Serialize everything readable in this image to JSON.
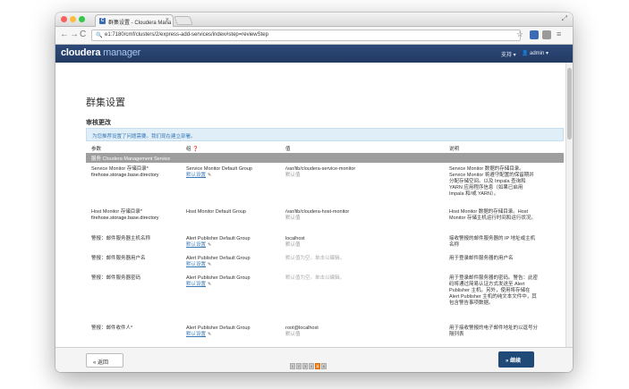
{
  "browser": {
    "tab_title": "群集设置 - Cloudera Mana",
    "tab_favicon": "C",
    "tab_close": "×",
    "url": "e1:7180/cmf/clusters/2/express-add-services/index#step=reviewStep",
    "url_icon": "🔍",
    "nav_back": "←",
    "nav_forward": "→",
    "nav_reload": "C",
    "star": "☆",
    "menu": "≡",
    "window_control": "⤢"
  },
  "header": {
    "logo_main": "cloudera",
    "logo_sub": "manager",
    "support_label": "支持 ▾",
    "user_label": "admin ▾"
  },
  "page": {
    "title": "群集设置",
    "section_title": "审核更改",
    "info_text": "为您推荐设置了问题需要。我们现在建立部署。"
  },
  "table": {
    "headers": [
      "参数",
      "组 ❓",
      "值",
      "说明"
    ],
    "group_label": "服务 Cloudera Management Service",
    "rows": [
      {
        "param": "Service Monitor 存储目录*",
        "param_sub": "firehose.storage.base.directory",
        "group": "Service Monitor Default Group",
        "group_link": "默认设置",
        "value": "/var/lib/cloudera-service-monitor",
        "value_sub": "默认值",
        "desc": "Service Monitor 数据的存储目录。Service Monitor 将遵守配置的保留期并分配存储空间。以及 Impala 查询和 YARN 应用程序信息（如果已启用 Impala 和/或 YARN）。"
      },
      {
        "param": "Host Monitor 存储目录*",
        "param_sub": "firehose.storage.base.directory",
        "group": "Host Monitor Default Group",
        "group_link": "",
        "value": "/var/lib/cloudera-host-monitor",
        "value_sub": "默认值",
        "desc": "Host Monitor 数据的存储目录。Host Monitor 存储主机运行时间和运行状况。"
      },
      {
        "param": "警报：邮件服务器主机名称",
        "param_sub": "",
        "group": "Alert Publisher Default Group",
        "group_link": "默认设置",
        "value": "localhost",
        "value_sub": "默认值",
        "desc": "接收警报的邮件服务器的 IP 地址或主机名称"
      },
      {
        "param": "警报：邮件服务器用户名",
        "param_sub": "",
        "group": "Alert Publisher Default Group",
        "group_link": "默认设置",
        "value": "默认值为空。单击以编辑。",
        "value_sub": "",
        "desc": "用于登录邮件服务器的用户名"
      },
      {
        "param": "警报：邮件服务器密码",
        "param_sub": "",
        "group": "Alert Publisher Default Group",
        "group_link": "默认设置",
        "value": "默认值为空。单击以编辑。",
        "value_sub": "",
        "desc": "用于登录邮件服务器的密码。警告：此密码将通过简易认证方式发送至 Alert Publisher 主机。另外，使用将存储在 Alert Publisher 主机的纯文本文件中，其包含警告事项数据。"
      },
      {
        "param": "警报：邮件收件人*",
        "param_sub": "",
        "group": "Alert Publisher Default Group",
        "group_link": "默认设置",
        "value": "root@localhost",
        "value_sub": "默认值",
        "desc": "用于接收警报的电子邮件地址的以逗号分隔列表"
      }
    ]
  },
  "footer": {
    "back_label": "返回",
    "continue_label": "继续",
    "steps": [
      "1",
      "2",
      "3",
      "4",
      "5",
      "6"
    ],
    "active_step": 4
  },
  "colors": {
    "header_bg": "#2e4a7a",
    "accent": "#3a7ab8",
    "active_step": "#f08a24",
    "continue_btn": "#1f4a78"
  }
}
